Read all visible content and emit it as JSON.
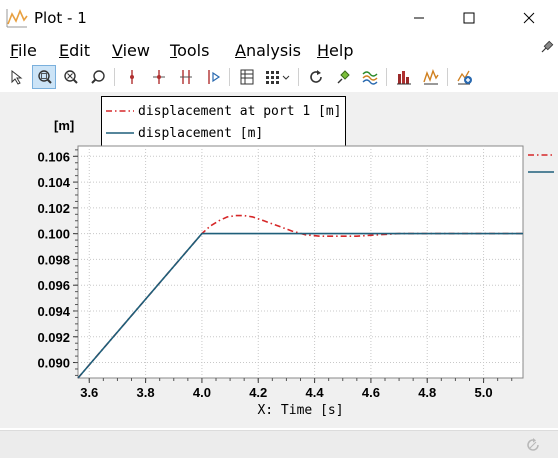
{
  "window": {
    "title": "Plot - 1"
  },
  "menu": [
    {
      "label": "File",
      "key": "F",
      "rest": "ile"
    },
    {
      "label": "Edit",
      "key": "E",
      "rest": "dit"
    },
    {
      "label": "View",
      "key": "V",
      "rest": "iew"
    },
    {
      "label": "Tools",
      "key": "T",
      "rest": "ools"
    },
    {
      "label": "Analysis",
      "key": "A",
      "rest": "nalysis"
    },
    {
      "label": "Help",
      "key": "H",
      "rest": "elp"
    }
  ],
  "toolbar": {
    "icons": [
      "select-arrow-icon",
      "zoom-box-icon",
      "zoom-out-icon",
      "zoom-in-icon",
      "marker-single-icon",
      "marker-cross-icon",
      "marker-double-icon",
      "marker-play-icon",
      "table-icon",
      "grid-menu-icon",
      "refresh-icon",
      "pin-tool-icon",
      "waves-icon",
      "histogram-icon",
      "fft-icon",
      "add-plot-icon"
    ],
    "active": "zoom-box-icon"
  },
  "colors": {
    "series1": "#d62728",
    "series2": "#1f5f7a",
    "grid": "#c8c8c8",
    "plot_bg": "#ffffff",
    "frame_bg": "#f0f0f0"
  },
  "chart_data": {
    "type": "line",
    "ylabel": "[m]",
    "xlabel": "X: Time [s]",
    "xlim": [
      3.56,
      5.14
    ],
    "ylim": [
      0.0888,
      0.1068
    ],
    "xticks": [
      3.6,
      3.8,
      4.0,
      4.2,
      4.4,
      4.6,
      4.8,
      5.0
    ],
    "xtick_labels": [
      "3.6",
      "3.8",
      "4.0",
      "4.2",
      "4.4",
      "4.6",
      "4.8",
      "5.0"
    ],
    "yticks": [
      0.09,
      0.092,
      0.094,
      0.096,
      0.098,
      0.1,
      0.102,
      0.104,
      0.106
    ],
    "ytick_labels": [
      "0.090",
      "0.092",
      "0.094",
      "0.096",
      "0.098",
      "0.100",
      "0.102",
      "0.104",
      "0.106"
    ],
    "grid": true,
    "legend_position": "top-left",
    "series": [
      {
        "name": "displacement at port 1 [m]",
        "style": "dash-dot",
        "color": "#d62728",
        "x": [
          3.56,
          4.0,
          4.03,
          4.06,
          4.09,
          4.12,
          4.15,
          4.18,
          4.22,
          4.27,
          4.32,
          4.37,
          4.42,
          4.48,
          4.55,
          4.62,
          4.7,
          4.8,
          4.9,
          5.0,
          5.14
        ],
        "y": [
          0.0888,
          0.1,
          0.1006,
          0.101,
          0.1013,
          0.1014,
          0.1014,
          0.1013,
          0.101,
          0.1006,
          0.1002,
          0.0999,
          0.0998,
          0.0998,
          0.0998,
          0.0999,
          0.1,
          0.1,
          0.1,
          0.1,
          0.1
        ]
      },
      {
        "name": "displacement [m]",
        "style": "solid",
        "color": "#1f5f7a",
        "x": [
          3.56,
          4.0,
          4.2,
          4.4,
          4.6,
          4.8,
          5.0,
          5.14
        ],
        "y": [
          0.0888,
          0.1,
          0.1,
          0.1,
          0.1,
          0.1,
          0.1,
          0.1
        ]
      }
    ]
  }
}
